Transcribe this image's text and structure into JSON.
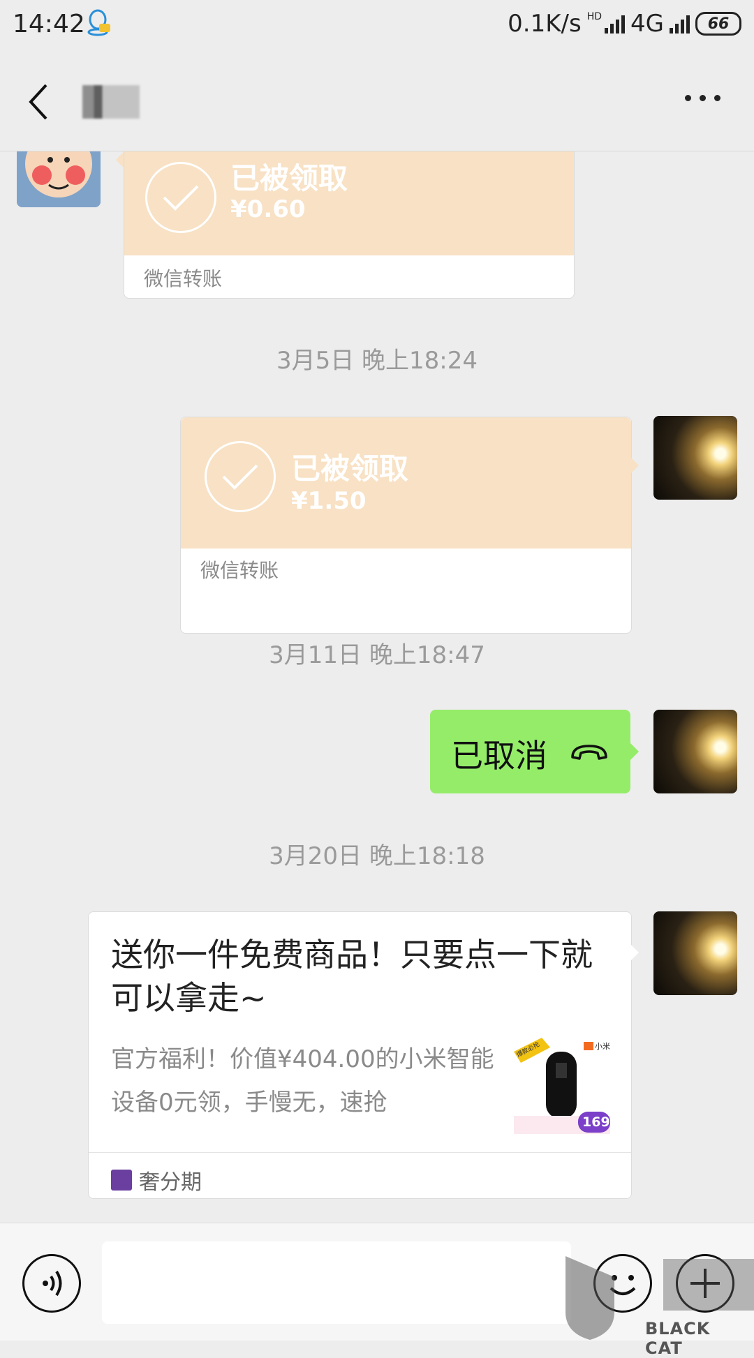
{
  "status_bar": {
    "time": "14:42",
    "speed": "0.1K/s",
    "hd": "HD",
    "network": "4G",
    "battery": "66",
    "icons": [
      "qq-icon",
      "signal-icon",
      "battery-icon"
    ]
  },
  "nav": {
    "back_icon": "chevron-left-icon",
    "more_icon": "more-dots-icon"
  },
  "messages": {
    "transfer1": {
      "status": "已被领取",
      "amount": "¥0.60",
      "footer": "微信转账"
    },
    "time1": "3月5日 晚上18:24",
    "transfer2": {
      "status": "已被领取",
      "amount": "¥1.50",
      "footer": "微信转账"
    },
    "time2": "3月11日 晚上18:47",
    "call": {
      "text": "已取消",
      "icon": "hangup-phone-icon"
    },
    "time3": "3月20日 晚上18:18",
    "card": {
      "title": "送你一件免费商品！只要点一下就可以拿走~",
      "description": "官方福利！价值¥404.00的小米智能设备0元领，手慢无，速抢",
      "thumb_price": "169",
      "thumb_brand": "小米",
      "thumb_badge": "爆款必抢",
      "source": "奢分期"
    }
  },
  "input_bar": {
    "voice_icon": "voice-icon",
    "emoji_icon": "emoji-icon",
    "plus_icon": "plus-icon"
  },
  "watermark": {
    "text": "BLACK CAT"
  },
  "colors": {
    "background": "#ededed",
    "transfer_top": "#f8e1c4",
    "call_bubble": "#95ec69"
  }
}
